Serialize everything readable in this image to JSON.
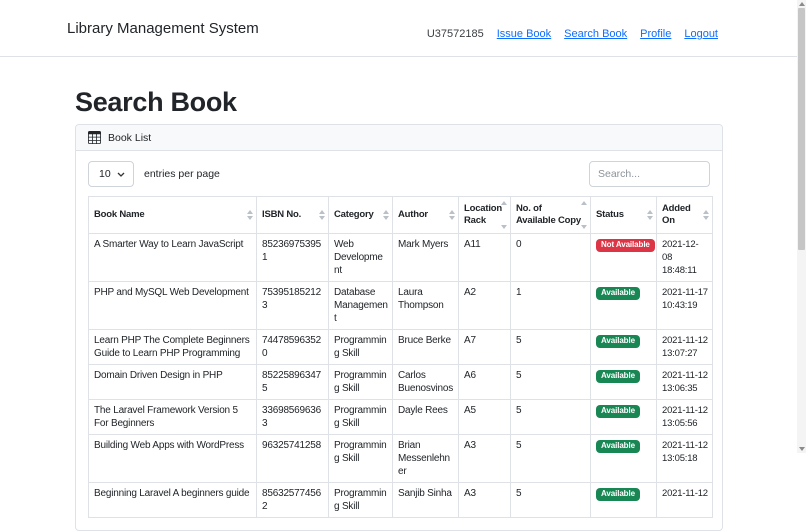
{
  "colors": {
    "link": "#0d6efd",
    "status_badge": {
      "Available": "#198754",
      "Not Available": "#dc3545"
    }
  },
  "navbar": {
    "brand": "Library Management System",
    "user_id": "U37572185",
    "links": [
      {
        "label": "Issue Book"
      },
      {
        "label": "Search Book"
      },
      {
        "label": "Profile"
      },
      {
        "label": "Logout"
      }
    ]
  },
  "page": {
    "title": "Search Book"
  },
  "panel": {
    "title": "Book List",
    "icon": "table-icon",
    "entries_selected": "10",
    "entries_label": "entries per page",
    "search_placeholder": "Search..."
  },
  "table": {
    "columns": [
      "Book Name",
      "ISBN No.",
      "Category",
      "Author",
      "Location Rack",
      "No. of Available Copy",
      "Status",
      "Added On"
    ],
    "rows": [
      {
        "book_name": "A Smarter Way to Learn JavaScript",
        "isbn": "852369753951",
        "category": "Web Development",
        "author": "Mark Myers",
        "location_rack": "A11",
        "available_copies": "0",
        "status": "Not Available",
        "added_date": "2021-12-08",
        "added_time": "18:48:11"
      },
      {
        "book_name": "PHP and MySQL Web Development",
        "isbn": "753951852123",
        "category": "Database Management",
        "author": "Laura Thompson",
        "location_rack": "A2",
        "available_copies": "1",
        "status": "Available",
        "added_date": "2021-11-17",
        "added_time": "10:43:19"
      },
      {
        "book_name": "Learn PHP The Complete Beginners Guide to Learn PHP Programming",
        "isbn": "744785963520",
        "category": "Programming Skill",
        "author": "Bruce Berke",
        "location_rack": "A7",
        "available_copies": "5",
        "status": "Available",
        "added_date": "2021-11-12",
        "added_time": "13:07:27"
      },
      {
        "book_name": "Domain Driven Design in PHP",
        "isbn": "852258963475",
        "category": "Programming Skill",
        "author": "Carlos Buenosvinos",
        "location_rack": "A6",
        "available_copies": "5",
        "status": "Available",
        "added_date": "2021-11-12",
        "added_time": "13:06:35"
      },
      {
        "book_name": "The Laravel Framework Version 5 For Beginners",
        "isbn": "336985696363",
        "category": "Programming Skill",
        "author": "Dayle Rees",
        "location_rack": "A5",
        "available_copies": "5",
        "status": "Available",
        "added_date": "2021-11-12",
        "added_time": "13:05:56"
      },
      {
        "book_name": "Building Web Apps with WordPress",
        "isbn": "96325741258",
        "category": "Programming Skill",
        "author": "Brian Messenlehner",
        "location_rack": "A3",
        "available_copies": "5",
        "status": "Available",
        "added_date": "2021-11-12",
        "added_time": "13:05:18"
      },
      {
        "book_name": "Beginning Laravel A beginners guide",
        "isbn": "856325774562",
        "category": "Programming Skill",
        "author": "Sanjib Sinha",
        "location_rack": "A3",
        "available_copies": "5",
        "status": "Available",
        "added_date": "2021-11-12",
        "added_time": ""
      }
    ]
  }
}
